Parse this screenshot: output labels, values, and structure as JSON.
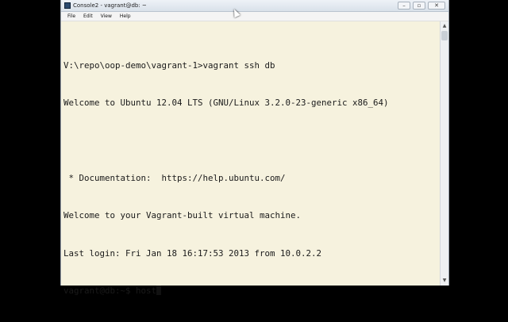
{
  "window": {
    "title": "Console2 - vagrant@db: ~",
    "controls": {
      "minimize": "–",
      "maximize": "▫",
      "close": "✕"
    }
  },
  "menu": {
    "items": [
      "File",
      "Edit",
      "View",
      "Help"
    ]
  },
  "terminal": {
    "lines": [
      "V:\\repo\\oop-demo\\vagrant-1>vagrant ssh db",
      "Welcome to Ubuntu 12.04 LTS (GNU/Linux 3.2.0-23-generic x86_64)",
      "",
      " * Documentation:  https://help.ubuntu.com/",
      "Welcome to your Vagrant-built virtual machine.",
      "Last login: Fri Jan 18 16:17:53 2013 from 10.0.2.2"
    ],
    "prompt_line": "vagrant@db:~$ host"
  },
  "scrollbar": {
    "up": "▲",
    "down": "▼"
  },
  "colors": {
    "terminal_bg": "#f6f2de",
    "terminal_fg": "#1a1a1a",
    "outer_bg": "#000000"
  }
}
